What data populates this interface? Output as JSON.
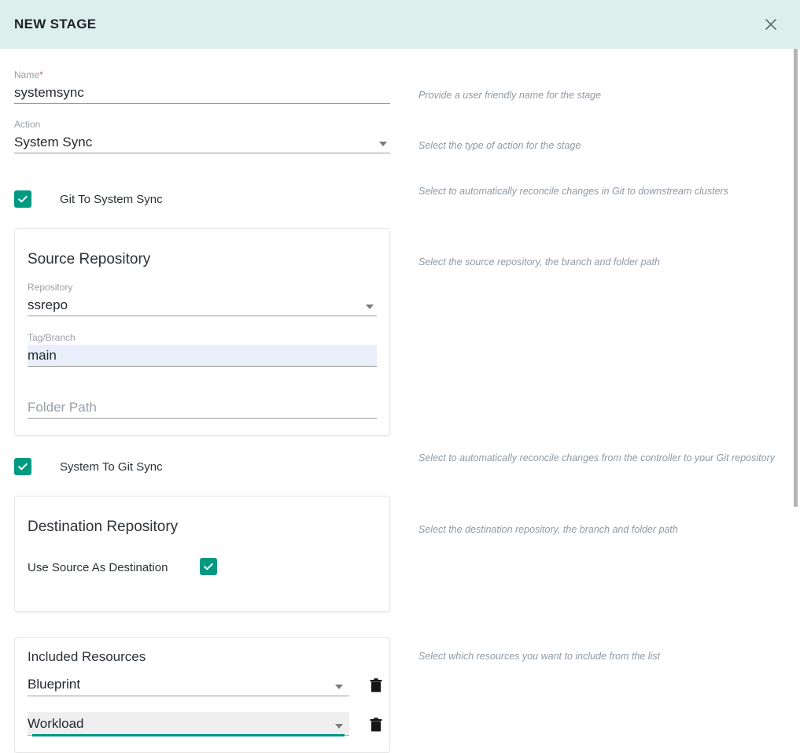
{
  "header": {
    "title": "NEW STAGE",
    "close_icon": "close-icon"
  },
  "form": {
    "name": {
      "label": "Name",
      "required_marker": "*",
      "value": "systemsync",
      "hint": "Provide a user friendly name for the stage"
    },
    "action": {
      "label": "Action",
      "value": "System Sync",
      "hint": "Select the type of action for the stage",
      "icon": "chevron-down-icon"
    },
    "git_to_system_sync": {
      "label": "Git To System Sync",
      "checked": true,
      "hint": "Select to automatically reconcile changes in Git to downstream clusters"
    },
    "source_repository": {
      "title": "Source Repository",
      "hint": "Select the source repository, the branch and folder path",
      "repository": {
        "label": "Repository",
        "value": "ssrepo",
        "icon": "chevron-down-icon"
      },
      "tag_branch": {
        "label": "Tag/Branch",
        "value": "main"
      },
      "folder_path": {
        "placeholder": "Folder Path",
        "value": ""
      }
    },
    "system_to_git_sync": {
      "label": "System To Git Sync",
      "checked": true,
      "hint": "Select to automatically reconcile changes from the controller to your Git repository"
    },
    "destination_repository": {
      "title": "Destination Repository",
      "hint": "Select the destination repository, the branch and folder path",
      "use_source_as_destination": {
        "label": "Use Source As Destination",
        "checked": true
      }
    },
    "included_resources": {
      "title": "Included Resources",
      "hint": "Select which resources you want to include from the list",
      "rows": [
        {
          "value": "Blueprint",
          "delete_icon": "trash-icon",
          "focused": false
        },
        {
          "value": "Workload",
          "delete_icon": "trash-icon",
          "focused": true
        }
      ]
    }
  },
  "colors": {
    "header_bg": "#dcefed",
    "accent_teal": "#009a82",
    "focus_underline": "#009688",
    "autofill_bg": "#e8eefa",
    "hint_text": "#8e9aa5"
  }
}
